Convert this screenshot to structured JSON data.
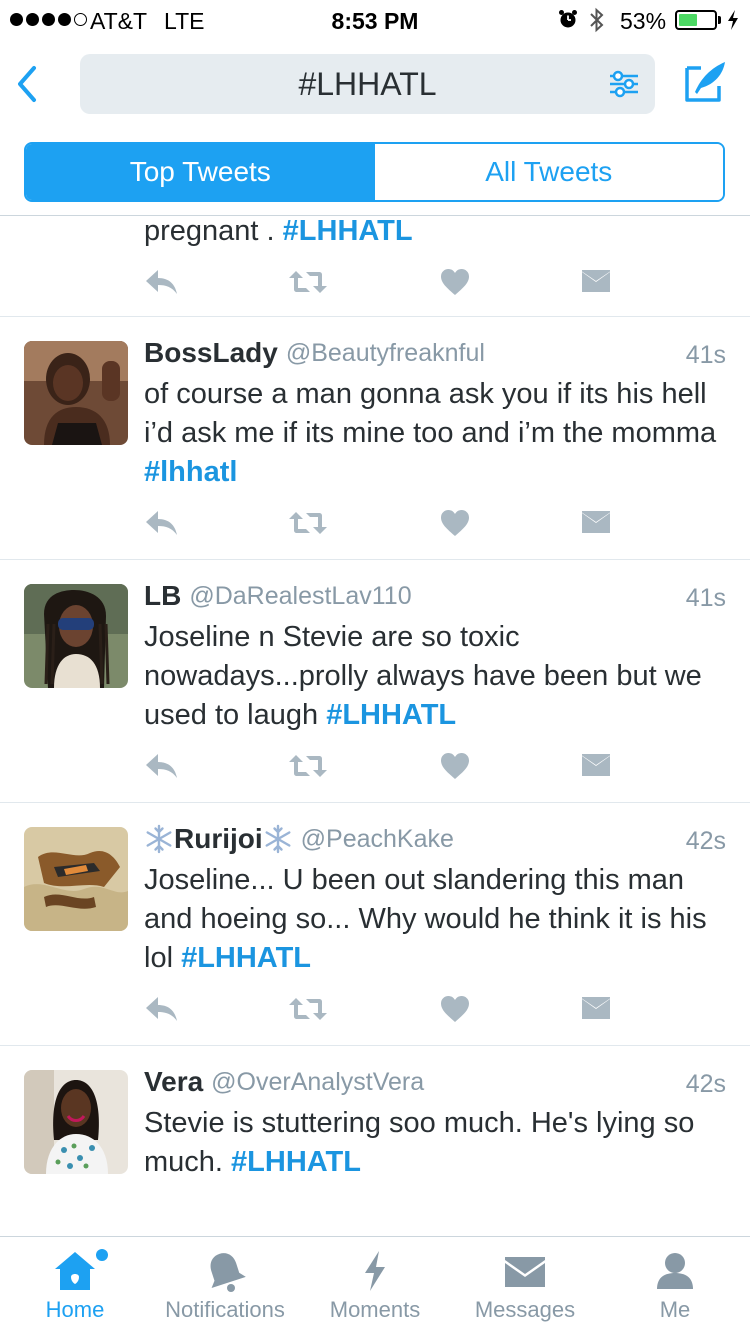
{
  "status_bar": {
    "carrier": "AT&T",
    "network": "LTE",
    "time": "8:53 PM",
    "battery_percent": "53%",
    "battery_level": 0.53
  },
  "header": {
    "search_query": "#LHHATL",
    "back_icon": "chevron-left-icon",
    "filter_icon": "sliders-icon",
    "compose_icon": "compose-feather-icon"
  },
  "tabs": {
    "top_tweets": "Top Tweets",
    "all_tweets": "All Tweets",
    "selected": "Top Tweets"
  },
  "feed": {
    "partial_tweet": {
      "text": "pregnant . ",
      "hashtag": "#LHHATL"
    },
    "tweets": [
      {
        "name": "BossLady",
        "handle": "@Beautyfreaknful",
        "time": "41s",
        "text": "of course a man gonna ask you if its his hell i’d ask me if its mine too and i’m the momma ",
        "hashtag": "#lhhatl"
      },
      {
        "name": "LB",
        "handle": "@DaRealestLav110",
        "time": "41s",
        "text": "Joseline n Stevie are so toxic nowadays...prolly always have been but we used to laugh ",
        "hashtag": "#LHHATL"
      },
      {
        "name": "Rurijoi",
        "handle": "@PeachKake",
        "time": "42s",
        "text": "Joseline... U been out slandering this man and hoeing so... Why would he think it is his lol ",
        "hashtag": "#LHHATL"
      },
      {
        "name": "Vera",
        "handle": "@OverAnalystVera",
        "time": "42s",
        "text": "Stevie is stuttering soo much. He's lying so much. ",
        "hashtag": "#LHHATL"
      }
    ]
  },
  "tab_bar": {
    "home": "Home",
    "notifications": "Notifications",
    "moments": "Moments",
    "messages": "Messages",
    "me": "Me",
    "active": "Home"
  },
  "colors": {
    "accent": "#1da1f2",
    "hashtag": "#1b95e0",
    "muted": "#8899a6",
    "action_icon": "#aab8c2",
    "search_bg": "#e6ecf0",
    "battery": "#4cd964"
  }
}
